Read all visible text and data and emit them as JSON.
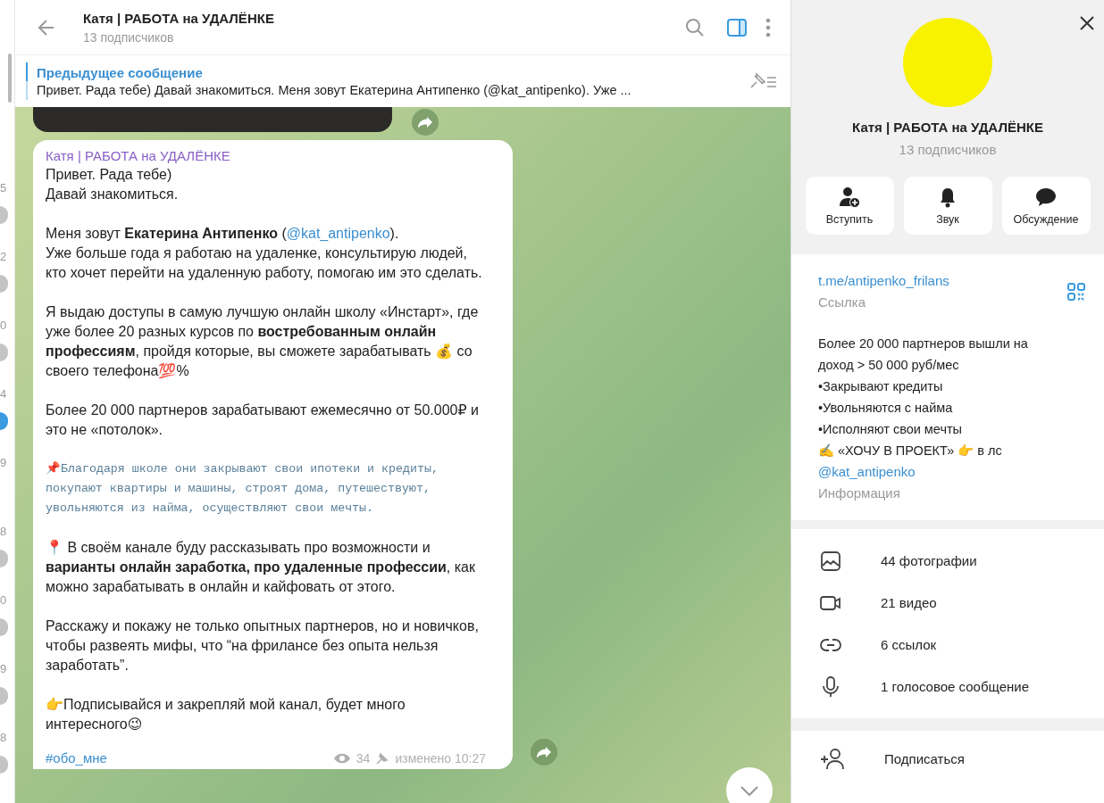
{
  "chat_list_fragments": [
    {
      "time": "5",
      "kind": "muted"
    },
    {
      "time": "2",
      "kind": "muted"
    },
    {
      "time": "0",
      "kind": "muted"
    },
    {
      "time": "4",
      "kind": "unread"
    },
    {
      "time": "9",
      "kind": "none"
    },
    {
      "time": "8",
      "kind": "muted"
    },
    {
      "time": "0",
      "kind": "muted"
    },
    {
      "time": "9",
      "kind": "muted"
    },
    {
      "time": "8",
      "kind": "muted"
    }
  ],
  "header": {
    "title": "Катя | РАБОТА на УДАЛЁНКЕ",
    "subtitle": "13 подписчиков",
    "info_panel_open": true
  },
  "pinned": {
    "label": "Предыдущее сообщение",
    "text": "Привет. Рада тебе) Давай знакомиться.   Меня зовут Екатерина Антипенко (@kat_antipenko). Уже ..."
  },
  "message": {
    "author": "Катя | РАБОТА на УДАЛЁНКЕ",
    "paragraphs": [
      {
        "kind": "normal",
        "segments": [
          {
            "kind": "plain",
            "text": "Привет. Рада тебе)\nДавай знакомиться."
          }
        ]
      },
      {
        "kind": "normal",
        "segments": [
          {
            "kind": "plain",
            "text": "Меня зовут "
          },
          {
            "kind": "bold",
            "text": "Екатерина Антипенко"
          },
          {
            "kind": "plain",
            "text": " ("
          },
          {
            "kind": "link",
            "text": "@kat_antipenko"
          },
          {
            "kind": "plain",
            "text": ").\nУже больше года я работаю на удаленке, консультирую людей, кто хочет перейти на удаленную работу, помогаю им это сделать."
          }
        ]
      },
      {
        "kind": "normal",
        "segments": [
          {
            "kind": "plain",
            "text": "Я выдаю доступы в самую лучшую онлайн школу «Инстарт», где уже более 20 разных курсов по "
          },
          {
            "kind": "bold",
            "text": "востребованным онлайн профессиям"
          },
          {
            "kind": "plain",
            "text": ", пройдя которые, вы сможете зарабатывать 💰 со своего телефона💯%"
          }
        ]
      },
      {
        "kind": "normal",
        "segments": [
          {
            "kind": "plain",
            "text": "Более 20 000 партнеров зарабатывают ежемесячно от 50.000₽ и это не «потолок»."
          }
        ]
      },
      {
        "kind": "mono",
        "segments": [
          {
            "kind": "plain",
            "text": "📌Благодаря школе они закрывают свои ипотеки и кредиты, покупают квартиры и машины, строят дома, путешествуют, увольняются из найма, осуществляют свои мечты."
          }
        ]
      },
      {
        "kind": "normal",
        "segments": [
          {
            "kind": "plain",
            "text": "📍 В своём канале буду рассказывать про возможности и "
          },
          {
            "kind": "bold",
            "text": "варианты онлайн заработка, про удаленные профессии"
          },
          {
            "kind": "plain",
            "text": ", как можно зарабатывать в онлайн и кайфовать от этого."
          }
        ]
      },
      {
        "kind": "normal",
        "segments": [
          {
            "kind": "plain",
            "text": "Расскажу и покажу не только опытных партнеров, но и новичков, чтобы развеять мифы, что “на фрилансе без опыта нельзя заработать”."
          }
        ]
      },
      {
        "kind": "normal",
        "segments": [
          {
            "kind": "plain",
            "text": "👉Подписывайся и закрепляй мой канал, будет много интересного😉"
          }
        ]
      }
    ],
    "hashtag": "#обо_мне",
    "views": "34",
    "pinned": true,
    "edited": "изменено 10:27"
  },
  "profile": {
    "name": "Катя | РАБОТА на УДАЛЁНКЕ",
    "subtitle": "13 подписчиков",
    "actions": [
      {
        "kind": "join",
        "label": "Вступить"
      },
      {
        "kind": "sound",
        "label": "Звук"
      },
      {
        "kind": "discussion",
        "label": "Обсуждение"
      }
    ],
    "link": "t.me/antipenko_frilans",
    "link_label": "Ссылка",
    "description": "Более 20 000 партнеров вышли на доход > 50 000 руб/мес\n•Закрывают кредиты\n•Увольняются с найма\n•Исполняют свои мечты\n✍️ «ХОЧУ В ПРОЕКТ» 👉 в лс",
    "description_mention": "@kat_antipenko",
    "description_label": "Информация",
    "media": [
      {
        "kind": "photo",
        "label": "44 фотографии"
      },
      {
        "kind": "video",
        "label": "21 видео"
      },
      {
        "kind": "link",
        "label": "6 ссылок"
      },
      {
        "kind": "voice",
        "label": "1 голосовое сообщение"
      }
    ],
    "subscribe": {
      "kind": "add_user",
      "label": "Подписаться"
    }
  }
}
